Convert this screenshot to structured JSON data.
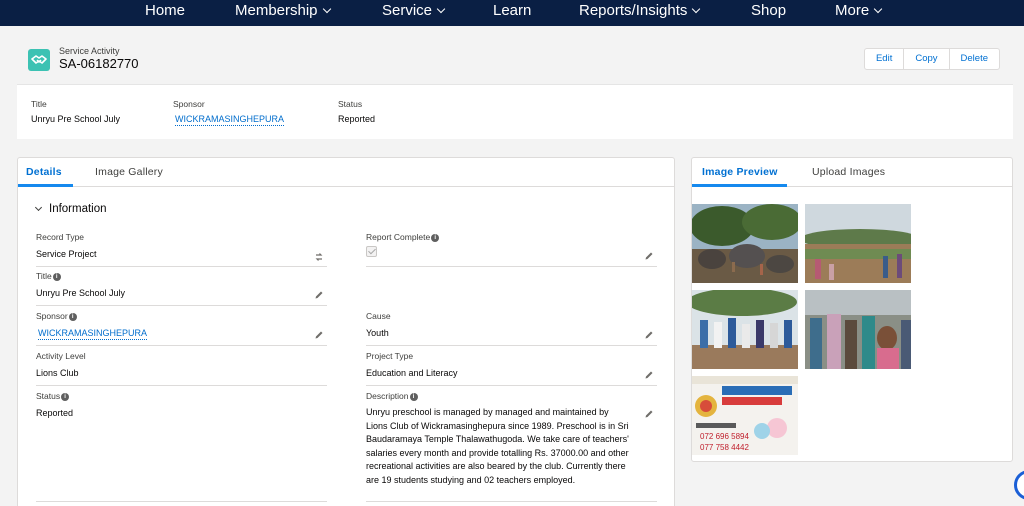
{
  "nav": {
    "items": [
      {
        "label": "Home",
        "dropdown": false
      },
      {
        "label": "Membership",
        "dropdown": true
      },
      {
        "label": "Service",
        "dropdown": true
      },
      {
        "label": "Learn",
        "dropdown": false
      },
      {
        "label": "Reports/Insights",
        "dropdown": true
      },
      {
        "label": "Shop",
        "dropdown": false
      },
      {
        "label": "More",
        "dropdown": true
      }
    ]
  },
  "record": {
    "type_label": "Service Activity",
    "name": "SA-06182770",
    "icon": "handshake-icon"
  },
  "actions": {
    "edit": "Edit",
    "copy": "Copy",
    "delete": "Delete"
  },
  "highlights": {
    "title_label": "Title",
    "title_value": "Unryu Pre School July",
    "sponsor_label": "Sponsor",
    "sponsor_value": "WICKRAMASINGHEPURA",
    "status_label": "Status",
    "status_value": "Reported"
  },
  "left_tabs": {
    "details": "Details",
    "gallery": "Image Gallery"
  },
  "section": {
    "title": "Information"
  },
  "fields": {
    "record_type": {
      "label": "Record Type",
      "value": "Service Project"
    },
    "report_complete": {
      "label": "Report Complete",
      "checked": true
    },
    "title": {
      "label": "Title",
      "value": "Unryu Pre School July"
    },
    "sponsor": {
      "label": "Sponsor",
      "value": "WICKRAMASINGHEPURA"
    },
    "cause": {
      "label": "Cause",
      "value": "Youth"
    },
    "activity_level": {
      "label": "Activity Level",
      "value": "Lions Club"
    },
    "project_type": {
      "label": "Project Type",
      "value": "Education and Literacy"
    },
    "status": {
      "label": "Status",
      "value": "Reported"
    },
    "description": {
      "label": "Description",
      "value": "Unryu preschool is managed by managed and maintained by Lions Club of Wickramasinghepura since 1989. Preschool is in Sri Baudaramaya Temple Thalawathugoda. We take care of teachers' salaries every month and provide totalling Rs. 37000.00 and other recreational activities are also beared by the club. Currently there are 19 students studying and 02 teachers employed."
    }
  },
  "right_tabs": {
    "preview": "Image Preview",
    "upload": "Upload Images"
  },
  "images": {
    "banner_phone_1": "072 696 5894",
    "banner_phone_2": "077 758 4442"
  },
  "colors": {
    "nav_bg": "#0a1f44",
    "accent": "#0070d2",
    "icon_teal": "#3cc2b3"
  }
}
